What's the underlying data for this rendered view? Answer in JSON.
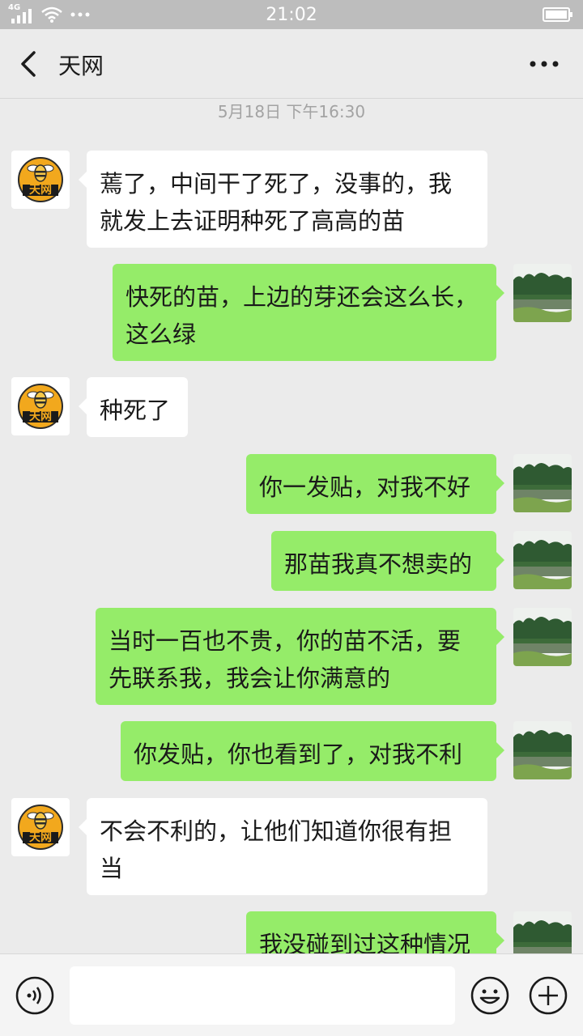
{
  "status_bar": {
    "network_label": "4G",
    "time": "21:02",
    "icons": [
      "signal-icon",
      "wifi-icon",
      "more-dots-icon",
      "battery-icon"
    ]
  },
  "header": {
    "title": "天网",
    "back_icon": "chevron-left-icon",
    "more_icon": "more-dots-icon"
  },
  "chat": {
    "timestamp": "5月18日 下午16:30",
    "contact_avatar_label": "天网",
    "messages": [
      {
        "from": "them",
        "lines": [
          "蔫了，中间干了死了，没事的，我",
          "就发上去证明种死了高高的苗"
        ]
      },
      {
        "from": "me",
        "lines": [
          "快死的苗，上边的芽还会这么长，",
          "这么绿"
        ]
      },
      {
        "from": "them",
        "lines": [
          "种死了"
        ]
      },
      {
        "from": "me",
        "lines": [
          "你一发贴，对我不好"
        ]
      },
      {
        "from": "me",
        "lines": [
          "那苗我真不想卖的"
        ]
      },
      {
        "from": "me",
        "lines": [
          "当时一百也不贵，你的苗不活，要",
          "先联系我，我会让你满意的"
        ]
      },
      {
        "from": "me",
        "lines": [
          "你发贴，你也看到了，对我不利"
        ]
      },
      {
        "from": "them",
        "lines": [
          "不会不利的，让他们知道你很有担",
          "当"
        ]
      },
      {
        "from": "me",
        "lines": [
          "我没碰到过这种情况"
        ]
      }
    ]
  },
  "input_bar": {
    "value": "",
    "icons": [
      "voice-icon",
      "emoji-icon",
      "plus-icon"
    ]
  },
  "colors": {
    "outgoing_bubble": "#95ec69",
    "incoming_bubble": "#ffffff",
    "background": "#ebebeb",
    "status_bar": "#bdbdbd"
  }
}
